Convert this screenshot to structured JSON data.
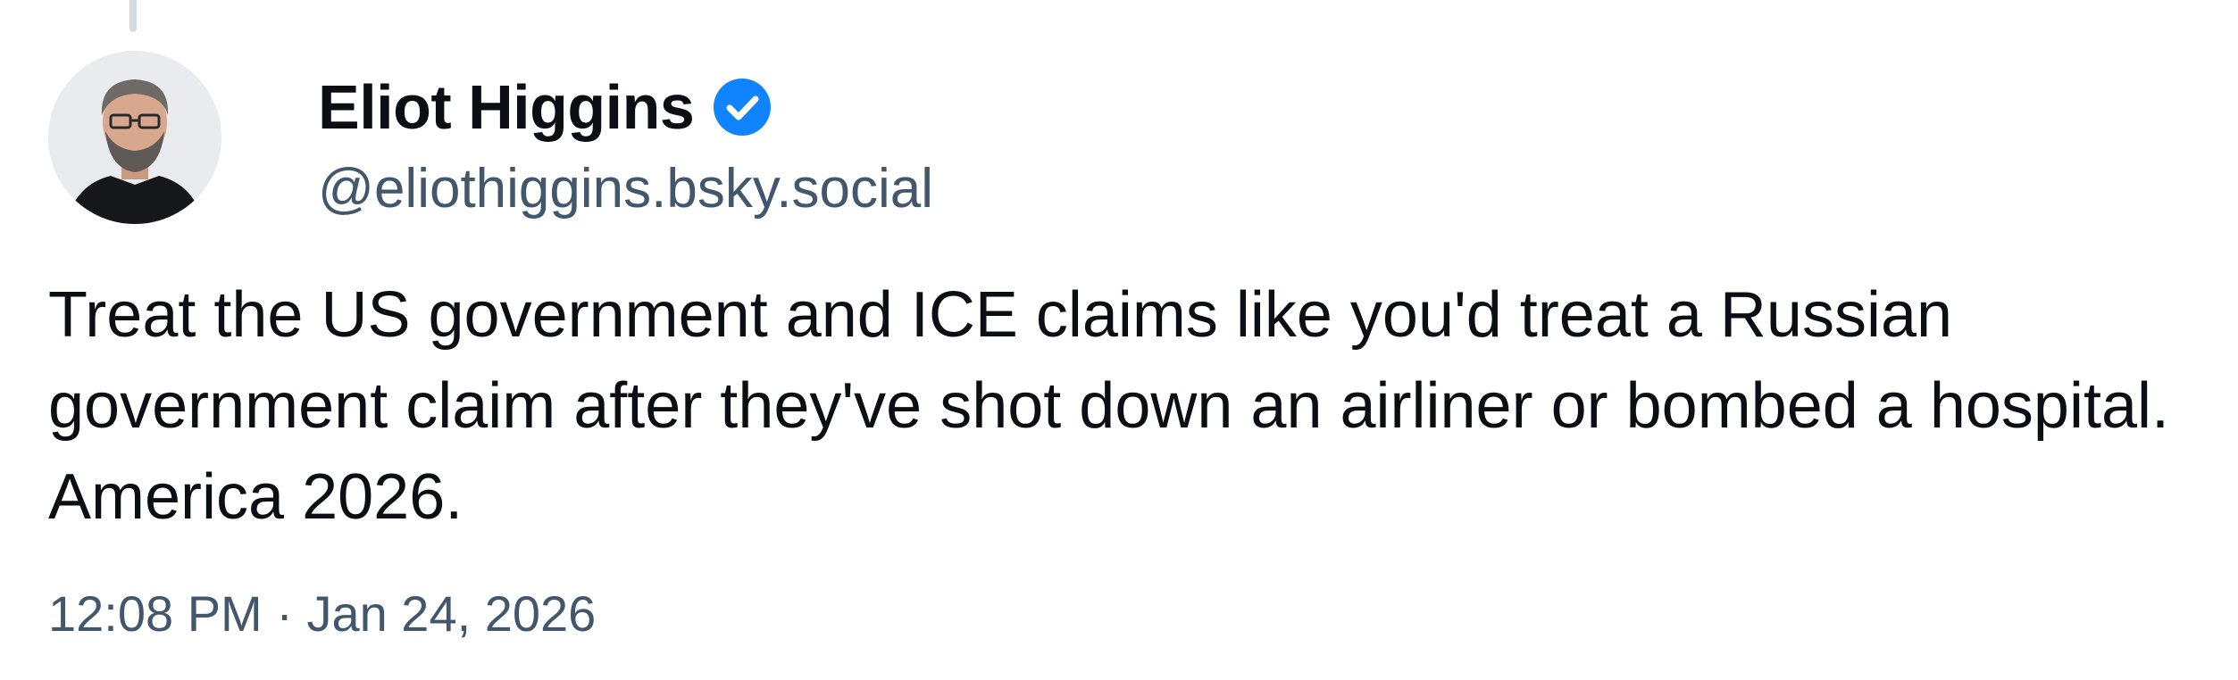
{
  "author": {
    "display_name": "Eliot Higgins",
    "handle": "@eliothiggins.bsky.social",
    "verified": true,
    "avatar_icon": "avatar-photo",
    "verified_icon": "verified-check-icon"
  },
  "post": {
    "text": "Treat the US government and ICE claims like you'd treat a Russian government claim after they've shot down an airliner or bombed a hospital. America 2026.",
    "timestamp": "12:08 PM · Jan 24, 2026"
  },
  "colors": {
    "text": "#0b0f14",
    "muted": "#42576c",
    "verified_badge": "#1083fe",
    "thread_line": "#d4dbe2"
  }
}
